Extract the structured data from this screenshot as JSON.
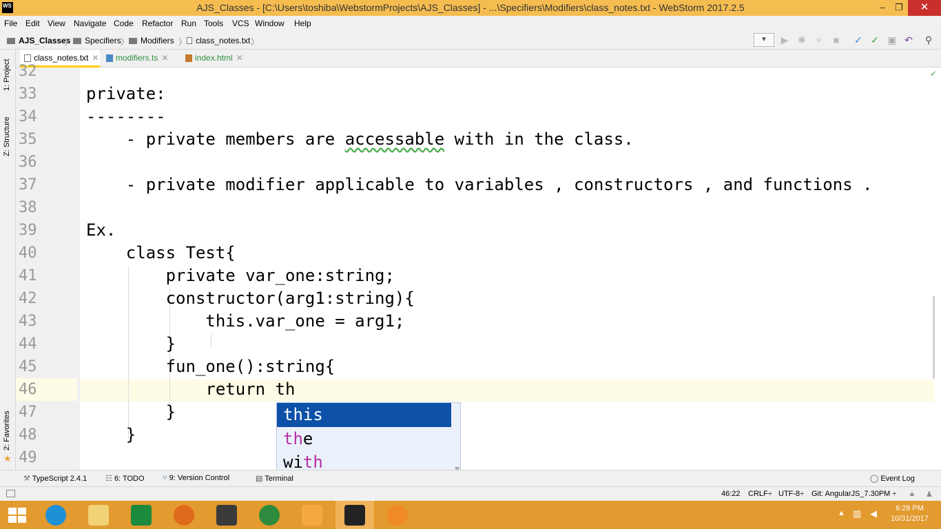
{
  "window": {
    "title": "AJS_Classes - [C:\\Users\\toshiba\\WebstormProjects\\AJS_Classes] - ...\\Specifiers\\Modifiers\\class_notes.txt - WebStorm 2017.2.5",
    "app_badge": "WS",
    "minimize": "‒",
    "restore": "❐",
    "close": "✕"
  },
  "menu": [
    "File",
    "Edit",
    "View",
    "Navigate",
    "Code",
    "Refactor",
    "Run",
    "Tools",
    "VCS",
    "Window",
    "Help"
  ],
  "breadcrumb": [
    "AJS_Classes",
    "Specifiers",
    "Modifiers",
    "class_notes.txt"
  ],
  "tabs": [
    {
      "label": "class_notes.txt",
      "active": true
    },
    {
      "label": "modifiers.ts",
      "active": false
    },
    {
      "label": "index.html",
      "active": false
    }
  ],
  "side_panels": {
    "project": "1: Project",
    "structure": "Z: Structure",
    "favorites": "2: Favorites"
  },
  "editor": {
    "lines": [
      {
        "n": "32",
        "text": ""
      },
      {
        "n": "33",
        "text": "private:"
      },
      {
        "n": "34",
        "text": "--------"
      },
      {
        "n": "35",
        "text": "    - private members are accessable with in the class."
      },
      {
        "n": "36",
        "text": ""
      },
      {
        "n": "37",
        "text": "    - private modifier applicable to variables , constructors , and functions ."
      },
      {
        "n": "38",
        "text": ""
      },
      {
        "n": "39",
        "text": "Ex."
      },
      {
        "n": "40",
        "text": "    class Test{"
      },
      {
        "n": "41",
        "text": "        private var_one:string;"
      },
      {
        "n": "42",
        "text": "        constructor(arg1:string){"
      },
      {
        "n": "43",
        "text": "            this.var_one = arg1;"
      },
      {
        "n": "44",
        "text": "        }"
      },
      {
        "n": "45",
        "text": "        fun_one():string{"
      },
      {
        "n": "46",
        "text": "            return th"
      },
      {
        "n": "47",
        "text": "        }"
      },
      {
        "n": "48",
        "text": "    }"
      },
      {
        "n": "49",
        "text": ""
      }
    ],
    "current_line": "46",
    "misspelled_word": "accessable"
  },
  "completion": {
    "typed": "th",
    "items": [
      {
        "text": "this",
        "selected": true
      },
      {
        "text": "the",
        "selected": false
      },
      {
        "text": "with",
        "selected": false
      }
    ],
    "corner_symbol": "π"
  },
  "tool_windows": [
    "TypeScript 2.4.1",
    "6: TODO",
    "9: Version Control",
    "Terminal"
  ],
  "event_log": "Event Log",
  "status": {
    "position": "46:22",
    "line_sep": "CRLF÷",
    "encoding": "UTF-8÷",
    "git": "Git: AngularJS_7.30PM ÷"
  },
  "clock": {
    "time": "6:28 PM",
    "date": "10/31/2017"
  },
  "colors": {
    "titlebar": "#f5bd50",
    "taskbar": "#e39a2e",
    "selection": "#0d51a8",
    "match": "#b62fa1"
  }
}
